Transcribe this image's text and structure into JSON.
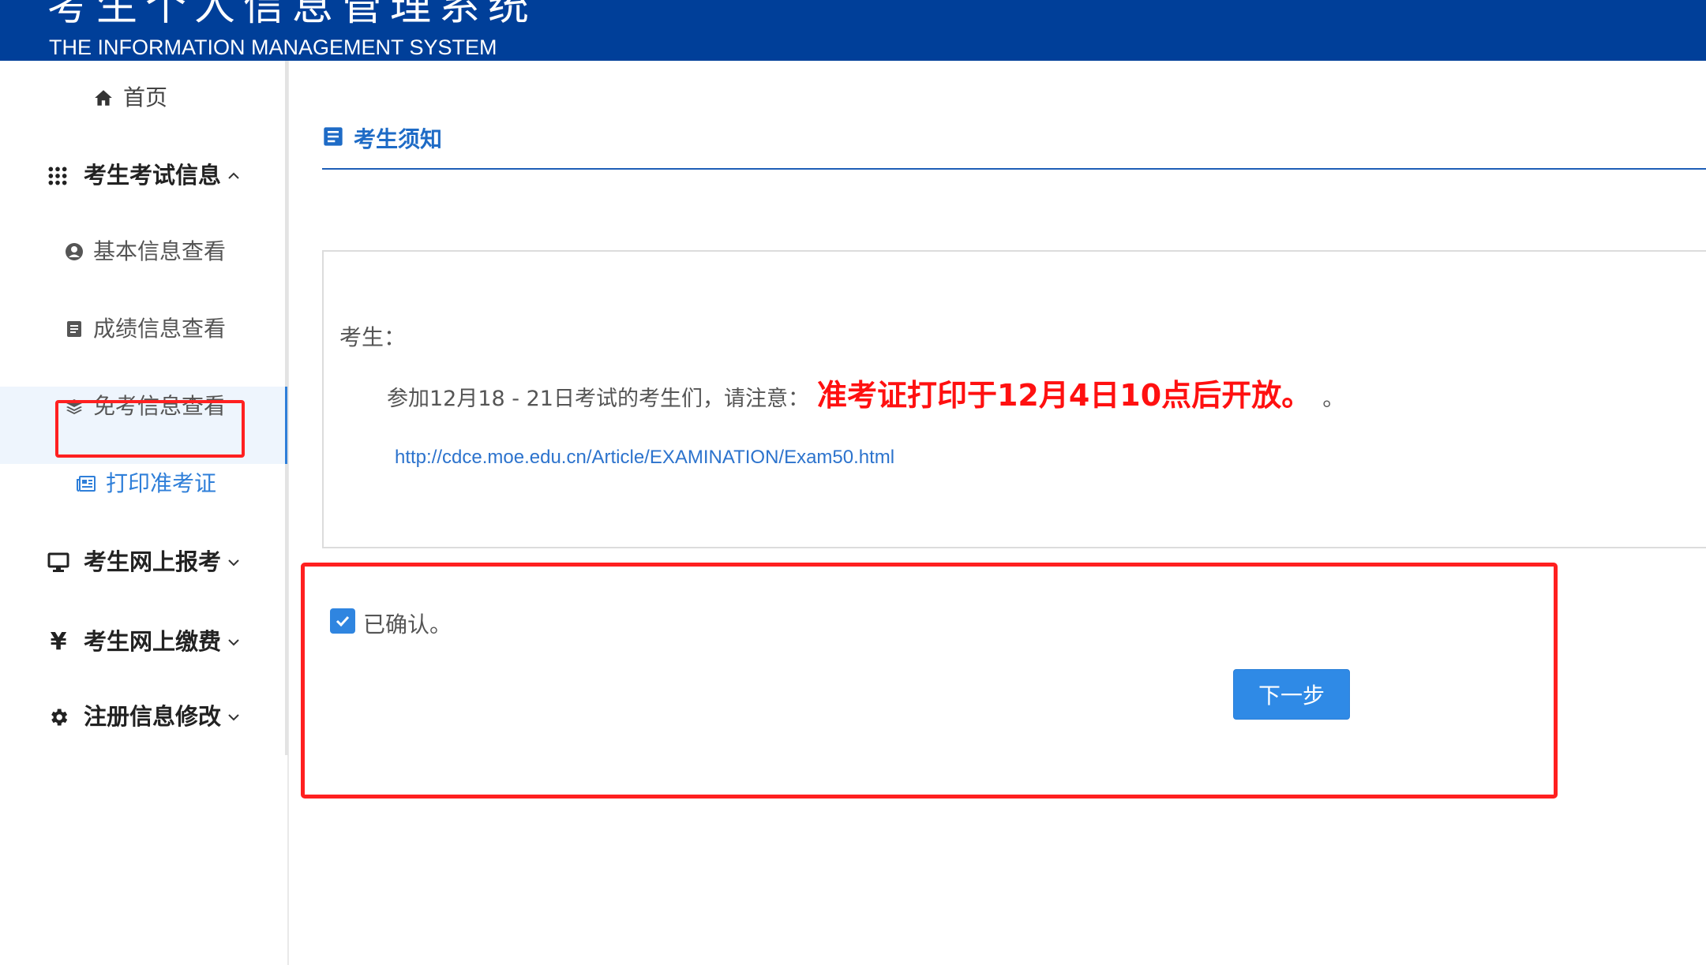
{
  "header": {
    "title_cn": "考生个人信息管理系统",
    "title_en": "THE INFORMATION MANAGEMENT SYSTEM",
    "bg_color": "#003f99"
  },
  "sidebar": {
    "home": {
      "label": "首页",
      "icon": "home-icon"
    },
    "exam_info": {
      "label": "考生考试信息",
      "icon": "grid-dots-icon",
      "expanded": true,
      "children": [
        {
          "label": "基本信息查看",
          "icon": "user-circle-icon"
        },
        {
          "label": "成绩信息查看",
          "icon": "document-icon"
        },
        {
          "label": "免考信息查看",
          "icon": "layers-icon"
        },
        {
          "label": "打印准考证",
          "icon": "newspaper-icon",
          "active": true
        }
      ]
    },
    "online_register": {
      "label": "考生网上报考",
      "icon": "monitor-icon",
      "expanded": false
    },
    "online_payment": {
      "label": "考生网上缴费",
      "icon": "yen-icon",
      "expanded": false
    },
    "register_edit": {
      "label": "注册信息修改",
      "icon": "gear-icon",
      "expanded": false
    }
  },
  "main": {
    "section_title": "考生须知",
    "notice": {
      "greeting": "考生：",
      "line_prefix": "参加12月18 - 21日考试的考生们，请注意：",
      "line_highlight": "准考证打印于12月4日10点后开放。",
      "line_suffix": "。",
      "link": "http://cdce.moe.edu.cn/Article/EXAMINATION/Exam50.html"
    },
    "confirm": {
      "checked": true,
      "label": "已确认。"
    },
    "next_button": "下一步"
  },
  "colors": {
    "accent": "#2f85e0",
    "highlight_red": "#ff1010",
    "annotation_red": "#ff2020"
  }
}
